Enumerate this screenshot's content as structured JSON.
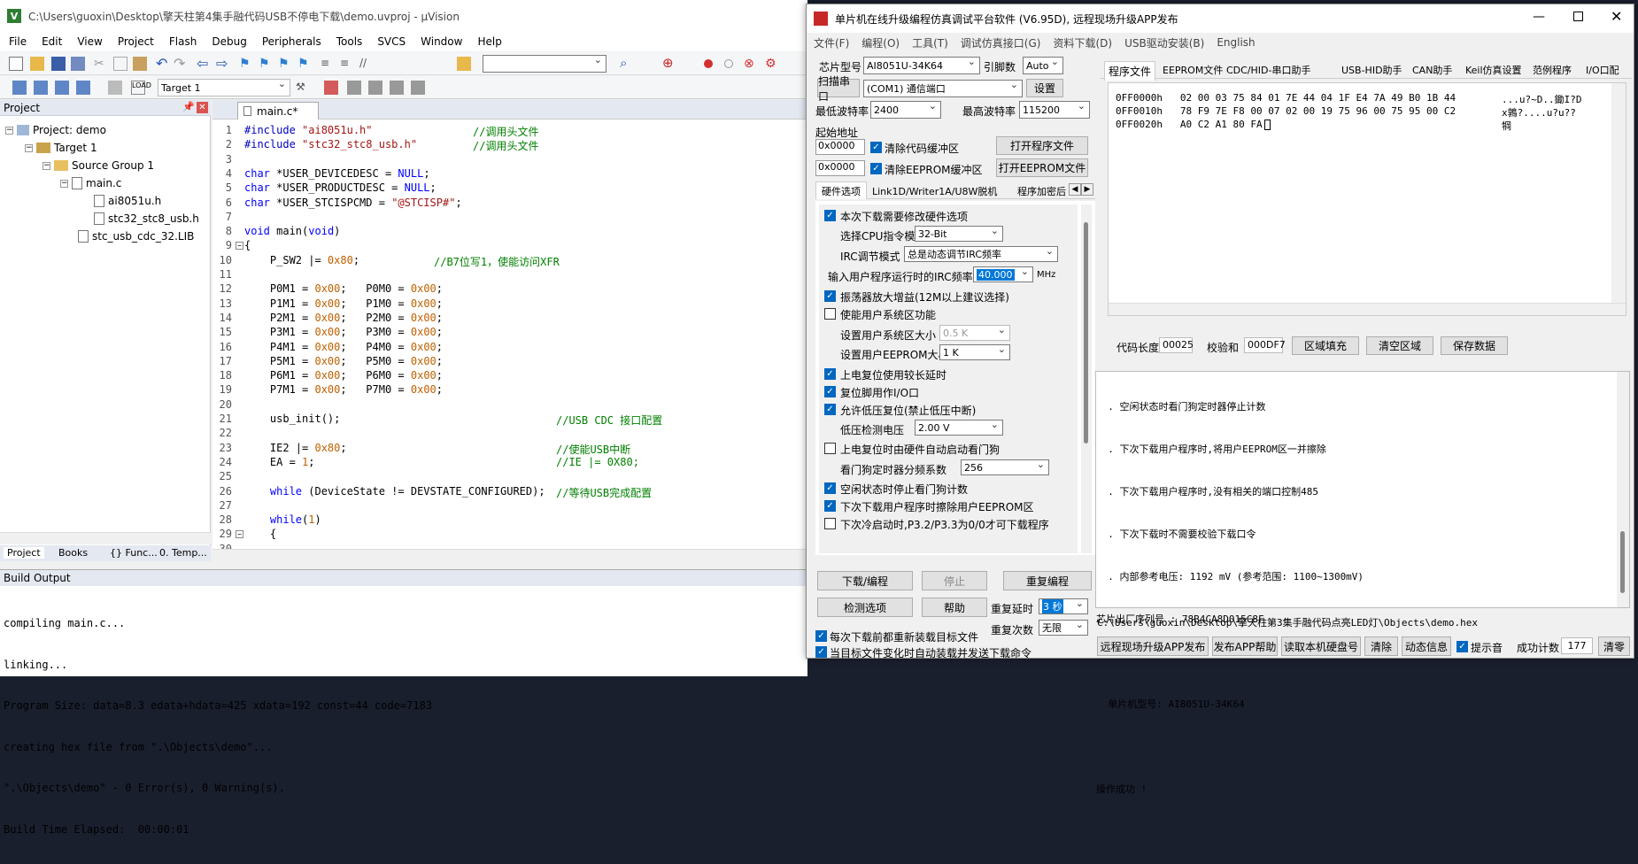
{
  "uv": {
    "title": "C:\\Users\\guoxin\\Desktop\\擎天柱第4集手融代码USB不停电下载\\demo.uvproj - µVision",
    "menu": [
      "File",
      "Edit",
      "View",
      "Project",
      "Flash",
      "Debug",
      "Peripherals",
      "Tools",
      "SVCS",
      "Window",
      "Help"
    ],
    "target": "Target 1",
    "project_header": "Project",
    "tree": [
      "Project: demo",
      "Target 1",
      "Source Group 1",
      "main.c",
      "ai8051u.h",
      "stc32_stc8_usb.h",
      "stc_usb_cdc_32.LIB"
    ],
    "bottom_tabs": [
      "Project",
      "Books",
      "{} Func...",
      "0. Temp..."
    ],
    "editor_tab": "main.c*",
    "line_numbers": [
      "1",
      "2",
      "3",
      "4",
      "5",
      "6",
      "7",
      "8",
      "9",
      "10",
      "11",
      "12",
      "13",
      "14",
      "15",
      "16",
      "17",
      "18",
      "19",
      "20",
      "21",
      "22",
      "23",
      "24",
      "25",
      "26",
      "27",
      "28",
      "29",
      "30"
    ],
    "build_header": "Build Output",
    "build_lines": [
      "compiling main.c...",
      "linking...",
      "Program Size: data=8.3 edata+hdata=425 xdata=192 const=44 code=7183",
      "creating hex file from \".\\Objects\\demo\"...",
      "\".\\Objects\\demo\" - 0 Error(s), 0 Warning(s).",
      "Build Time Elapsed:  00:00:01"
    ]
  },
  "code": [
    {
      "t": "#include \"ai8051u.h\"",
      "c": "//调用头文件"
    },
    {
      "t": "#include \"stc32_stc8_usb.h\"",
      "c": "//调用头文件"
    },
    {
      "t": "",
      "c": ""
    },
    {
      "t": "char *USER_DEVICEDESC = NULL;",
      "c": ""
    },
    {
      "t": "char *USER_PRODUCTDESC = NULL;",
      "c": ""
    },
    {
      "t": "char *USER_STCISPCMD = \"@STCISP#\";",
      "c": ""
    },
    {
      "t": "",
      "c": ""
    },
    {
      "t": "void main(void)",
      "c": ""
    },
    {
      "t": "{",
      "c": ""
    },
    {
      "t": "    P_SW2 |= 0x80;",
      "c": "//B7位写1，使能访问XFR"
    },
    {
      "t": "",
      "c": ""
    },
    {
      "t": "    P0M1 = 0x00;   P0M0 = 0x00;",
      "c": ""
    },
    {
      "t": "    P1M1 = 0x00;   P1M0 = 0x00;",
      "c": ""
    },
    {
      "t": "    P2M1 = 0x00;   P2M0 = 0x00;",
      "c": ""
    },
    {
      "t": "    P3M1 = 0x00;   P3M0 = 0x00;",
      "c": ""
    },
    {
      "t": "    P4M1 = 0x00;   P4M0 = 0x00;",
      "c": ""
    },
    {
      "t": "    P5M1 = 0x00;   P5M0 = 0x00;",
      "c": ""
    },
    {
      "t": "    P6M1 = 0x00;   P6M0 = 0x00;",
      "c": ""
    },
    {
      "t": "    P7M1 = 0x00;   P7M0 = 0x00;",
      "c": ""
    },
    {
      "t": "",
      "c": ""
    },
    {
      "t": "    usb_init();",
      "c": "//USB CDC 接口配置"
    },
    {
      "t": "",
      "c": ""
    },
    {
      "t": "    IE2 |= 0x80;",
      "c": "//使能USB中断"
    },
    {
      "t": "    EA = 1;",
      "c": "//IE |= 0X80;"
    },
    {
      "t": "",
      "c": ""
    },
    {
      "t": "    while (DeviceState != DEVSTATE_CONFIGURED);",
      "c": "//等待USB完成配置"
    },
    {
      "t": "",
      "c": ""
    },
    {
      "t": "    while(1)",
      "c": ""
    },
    {
      "t": "    {",
      "c": ""
    },
    {
      "t": "",
      "c": ""
    }
  ],
  "isp": {
    "title": "单片机在线升级编程仿真调试平台软件 (V6.95D), 远程现场升级APP发布",
    "menu": [
      "文件(F)",
      "编程(O)",
      "工具(T)",
      "调试仿真接口(G)",
      "资料下载(D)",
      "USB驱动安装(B)",
      "English"
    ],
    "chip_label": "芯片型号",
    "chip_value": "AI8051U-34K64",
    "pin_label": "引脚数",
    "pin_value": "Auto",
    "scan_label": "扫描串口",
    "port_value": "(COM1) 通信端口",
    "settings": "设置",
    "min_baud_label": "最低波特率",
    "min_baud": "2400",
    "max_baud_label": "最高波特率",
    "max_baud": "115200",
    "start_addr_label": "起始地址",
    "addr1": "0x0000",
    "clear_code": "清除代码缓冲区",
    "open_prog": "打开程序文件",
    "addr2": "0x0000",
    "clear_eeprom": "清除EEPROM缓冲区",
    "open_eeprom": "打开EEPROM文件",
    "left_tabs": [
      "硬件选项",
      "Link1D/Writer1A/U8W脱机",
      "程序加密后"
    ],
    "opts": {
      "modify_hw": "本次下载需要修改硬件选项",
      "cpu_mode_label": "选择CPU指令模式",
      "cpu_mode": "32-Bit",
      "irc_mode_label": "IRC调节模式",
      "irc_mode": "总是动态调节IRC频率",
      "freq_label": "输入用户程序运行时的IRC频率",
      "freq": "40.000",
      "mhz": "MHz",
      "osc_gain": "振荡器放大增益(12M以上建议选择)",
      "user_sys": "使能用户系统区功能",
      "sys_size_label": "设置用户系统区大小",
      "sys_size": "0.5 K",
      "eeprom_size_label": "设置用户EEPROM大小",
      "eeprom_size": "1  K",
      "long_reset": "上电复位使用较长延时",
      "reset_io": "复位脚用作I/O口",
      "lvr": "允许低压复位(禁止低压中断)",
      "lvd_label": "低压检测电压",
      "lvd": "2.00 V",
      "wdt_auto": "上电复位时由硬件自动启动看门狗",
      "wdt_div_label": "看门狗定时器分频系数",
      "wdt_div": "256",
      "idle_stop": "空闲状态时停止看门狗计数",
      "erase_eeprom": "下次下载用户程序时擦除用户EEPROM区",
      "cold_boot": "下次冷启动时,P3.2/P3.3为0/0才可下载程序"
    },
    "download": "下载/编程",
    "stop": "停止",
    "reprog": "重复编程",
    "detect": "检测选项",
    "help": "帮助",
    "repeat_delay_label": "重复延时",
    "repeat_delay": "3 秒",
    "repeat_count_label": "重复次数",
    "repeat_count": "无限",
    "reload_each": "每次下载前都重新装载目标文件",
    "auto_send": "当目标文件变化时自动装载并发送下载命令",
    "right_tabs": [
      "程序文件",
      "EEPROM文件",
      "CDC/HID-串口助手",
      "USB-HID助手",
      "CAN助手",
      "Keil仿真设置",
      "范例程序",
      "I/O口配"
    ],
    "hex_rows": [
      {
        "addr": "0FF0000h",
        "bytes": "02 00 03 75 84 01 7E 44 04 1F E4 7A 49 B0 1B 44",
        "ascii": "...u?~D..鋤I?D"
      },
      {
        "addr": "0FF0010h",
        "bytes": "78 F9 7E F8 00 07 02 00 19 75 96 00 75 95 00 C2",
        "ascii": "x鶉?....u?u??"
      },
      {
        "addr": "0FF0020h",
        "bytes": "A0 C2 A1 80 FA",
        "ascii": "犅  "
      }
    ],
    "code_len_label": "代码长度",
    "code_len": "00025",
    "checksum_label": "校验和",
    "checksum": "000DF7",
    "fill": "区域填充",
    "clear_area": "清空区域",
    "save": "保存数据",
    "log": [
      "  . 空闲状态时看门狗定时器停止计数",
      "  . 下次下载用户程序时,将用户EEPROM区一并擦除",
      "  . 下次下载用户程序时,没有相关的端口控制485",
      "  . 下次下载时不需要校验下载口令",
      "  . 内部参考电压: 1192 mV (参考范围: 1100~1300mV)",
      "芯片出厂序列号 : 78B4CA8D015C8F",
      "",
      "  单片机型号: AI8051U-34K64",
      "",
      "操作成功 !"
    ],
    "path": "C:\\Users\\guoxin\\Desktop\\擎天柱第3集手融代码点亮LED灯\\Objects\\demo.hex",
    "bottom": {
      "publish": "远程现场升级APP发布",
      "help": "发布APP帮助",
      "disk": "读取本机硬盘号",
      "clear": "清除",
      "dyn": "动态信息",
      "beep": "提示音",
      "count_label": "成功计数",
      "count": "177",
      "reset": "清零"
    }
  }
}
